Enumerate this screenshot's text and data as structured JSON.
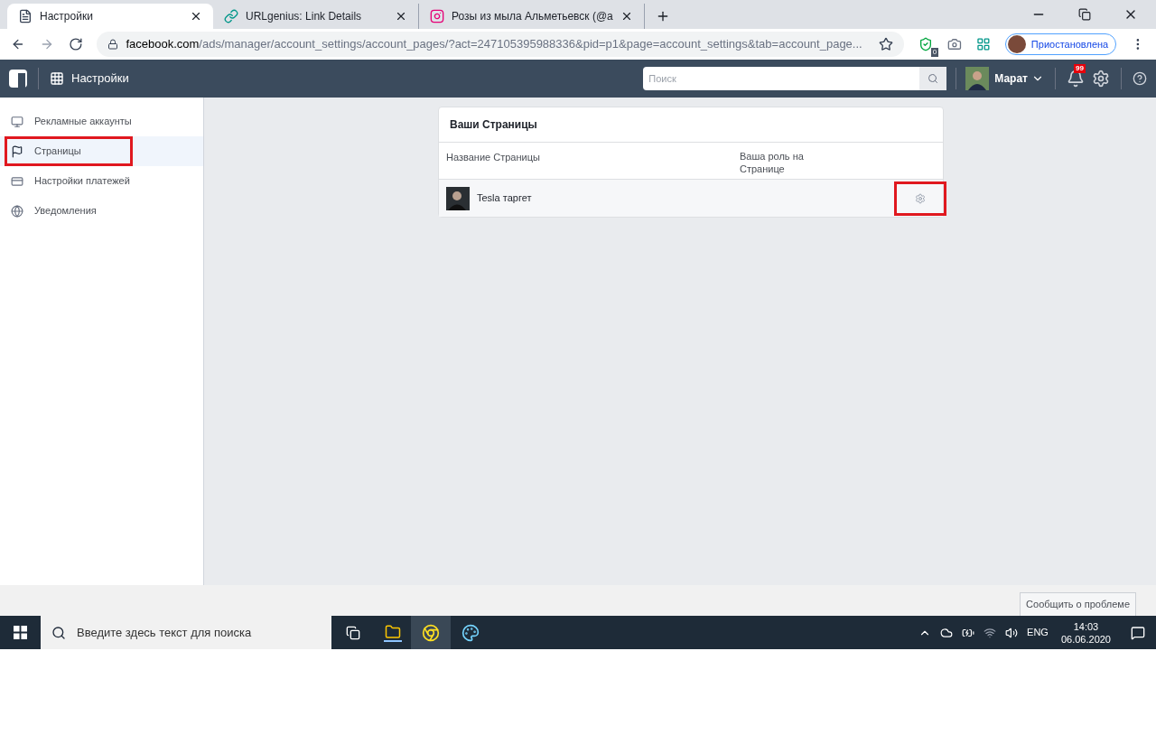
{
  "browser": {
    "tabs": [
      {
        "title": "Настройки",
        "selected": true,
        "kind": "page"
      },
      {
        "title": "URLgenius: Link Details",
        "selected": false,
        "kind": "link"
      },
      {
        "title": "Розы из мыла Альметьевск (@а",
        "selected": false,
        "kind": "insta"
      }
    ],
    "url": {
      "domain": "facebook.com",
      "path": "/ads/manager/account_settings/account_pages/?act=247105395988336&pid=p1&page=account_settings&tab=account_page..."
    },
    "extension_badge": "0",
    "profile_status": "Приостановлена"
  },
  "topbar": {
    "title": "Настройки",
    "search": {
      "placeholder": "Поиск"
    },
    "user": "Марат",
    "notifications": "99"
  },
  "sidebar": {
    "items": [
      {
        "label": "Рекламные аккаунты",
        "kind": "accounts",
        "selected": false,
        "highlighted": false
      },
      {
        "label": "Страницы",
        "kind": "pages",
        "selected": true,
        "highlighted": true
      },
      {
        "label": "Настройки платежей",
        "kind": "payments",
        "selected": false,
        "highlighted": false
      },
      {
        "label": "Уведомления",
        "kind": "notifications",
        "selected": false,
        "highlighted": false
      }
    ]
  },
  "pages_card": {
    "title": "Ваши Страницы",
    "columns": [
      "Название Страницы",
      "Ваша роль на Странице"
    ],
    "rows": [
      {
        "name": "Tesla таргет",
        "settings_highlighted": true
      }
    ]
  },
  "report_button": "Сообщить о проблеме",
  "taskbar": {
    "search": {
      "placeholder": "Введите здесь текст для поиска"
    },
    "language": "ENG",
    "time": "14:03",
    "date": "06.06.2020"
  }
}
